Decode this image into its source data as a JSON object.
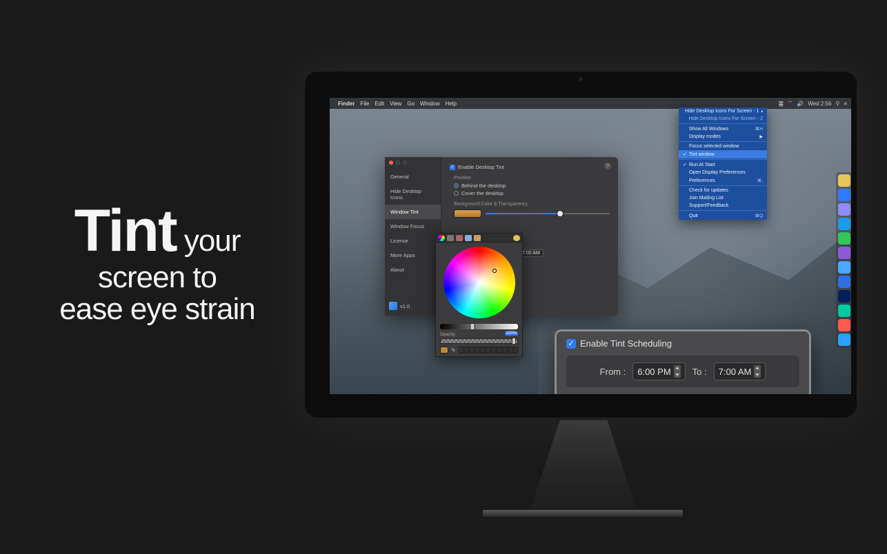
{
  "tagline": {
    "big": "Tint",
    "rest1": " your",
    "line2": "screen to",
    "line3": "ease eye strain"
  },
  "menubar": {
    "app": "Finder",
    "items": [
      "File",
      "Edit",
      "View",
      "Go",
      "Window",
      "Help"
    ],
    "clock": "Wed 2:56"
  },
  "prefs": {
    "sidebar": [
      "General",
      "Hide Desktop Icons",
      "Window Tint",
      "Window Focus",
      "License",
      "More Apps",
      "About"
    ],
    "version": "v1.0",
    "enable_label": "Enable Desktop Tint",
    "position_label": "Position",
    "pos_behind": "Behind the desktop",
    "pos_cover": "Cover the desktop",
    "bg_label": "Background Color & Transparency",
    "sched_time": "7:00 AM"
  },
  "picker": {
    "opacity_label": "Opacity",
    "opacity_value": "100%"
  },
  "status_menu": {
    "items": [
      {
        "label": "Hide Desktop Icons For Screen - 1",
        "indicator": "●"
      },
      {
        "label": "Hide Desktop Icons For Screen - 2",
        "disabled": true
      },
      {
        "sep": true
      },
      {
        "label": "Show All Windows",
        "shortcut": "⌘H"
      },
      {
        "label": "Display modes",
        "submenu": true
      },
      {
        "sep": true
      },
      {
        "label": "Focus selected window"
      },
      {
        "label": "Tint window",
        "checked": true,
        "selected": true
      },
      {
        "sep": true
      },
      {
        "label": "Run At Start",
        "checked": true
      },
      {
        "label": "Open Display Preferences"
      },
      {
        "label": "Preferences",
        "shortcut": "⌘,"
      },
      {
        "sep": true
      },
      {
        "label": "Check for updates"
      },
      {
        "label": "Join Mailing List"
      },
      {
        "label": "Support/Feedback"
      },
      {
        "sep": true
      },
      {
        "label": "Quit",
        "shortcut": "⌘Q"
      }
    ]
  },
  "callout": {
    "enable": "Enable Tint Scheduling",
    "from_label": "From :",
    "from_time": "6:00 PM",
    "to_label": "To :",
    "to_time": "7:00 AM"
  },
  "dock_colors": [
    "#e8c35a",
    "#2e7bff",
    "#8c8cff",
    "#1d9bf0",
    "#34c759",
    "#8e5bd8",
    "#4aa8ff",
    "#2f6fe0",
    "#001f5b",
    "#00c8a0",
    "#ff5a4d",
    "#2aa1ff"
  ]
}
